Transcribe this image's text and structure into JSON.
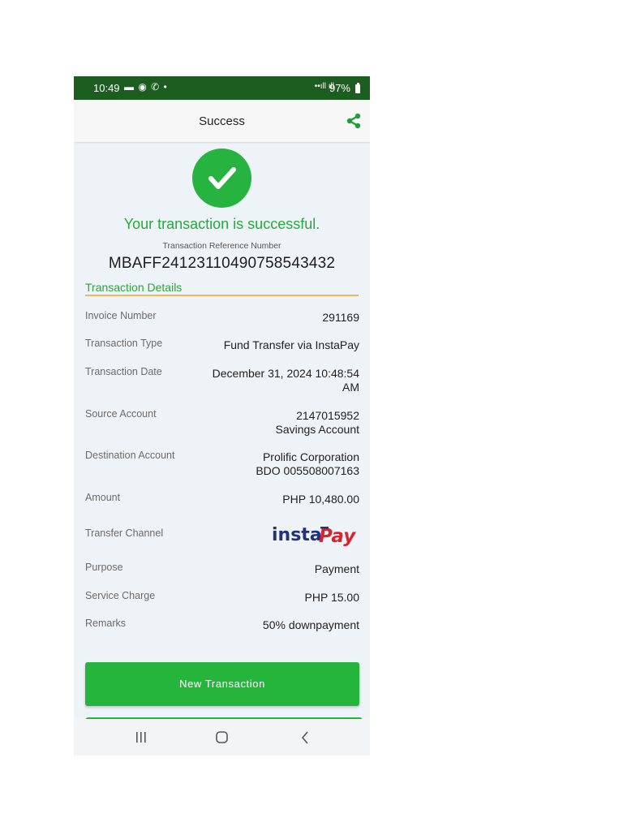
{
  "status_bar": {
    "time": "10:49",
    "left_icons": "▬ ◉ ✆ •",
    "signal": "••ıll ıll",
    "battery": "97%"
  },
  "app_bar": {
    "title": "Success",
    "share_icon": "share-icon"
  },
  "result": {
    "message": "Your transaction is successful.",
    "ref_label": "Transaction Reference Number",
    "ref_number": "MBAFF24123110490758543432",
    "accent_color": "#26b33f"
  },
  "details": {
    "title": "Transaction Details",
    "rows": [
      {
        "label": "Invoice Number",
        "value": "291169"
      },
      {
        "label": "Transaction Type",
        "value": "Fund Transfer via InstaPay"
      },
      {
        "label": "Transaction Date",
        "value": "December 31, 2024 10:48:54",
        "value2": "AM"
      },
      {
        "label": "Source Account",
        "value": "2147015952",
        "value2": "Savings Account"
      },
      {
        "label": "Destination Account",
        "value": "Prolific Corporation",
        "value2": "BDO 005508007163"
      },
      {
        "label": "Amount",
        "value": "PHP 10,480.00"
      },
      {
        "label": "Transfer Channel",
        "logo_text_a": "insta",
        "logo_text_b": "Pay"
      },
      {
        "label": "Purpose",
        "value": "Payment"
      },
      {
        "label": "Service Charge",
        "value": "PHP 15.00"
      },
      {
        "label": "Remarks",
        "value": "50% downpayment"
      }
    ]
  },
  "actions": {
    "new_transaction": "New Transaction"
  },
  "nav": {
    "recents": "recents-icon",
    "home": "home-icon",
    "back": "back-icon"
  }
}
